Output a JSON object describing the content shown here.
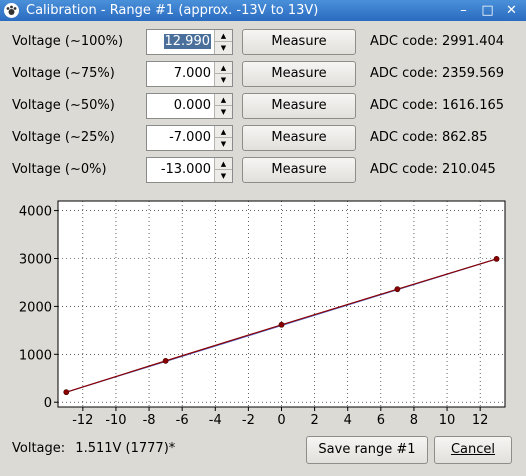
{
  "window": {
    "title": "Calibration - Range #1 (approx. -13V to 13V)",
    "minimize_glyph": "–",
    "maximize_glyph": "□",
    "close_glyph": "✕"
  },
  "rows": [
    {
      "label": "Voltage (~100%)",
      "value": "12.990",
      "button": "Measure",
      "adc": "ADC code: 2991.404",
      "selected": true
    },
    {
      "label": "Voltage (~75%)",
      "value": "7.000",
      "button": "Measure",
      "adc": "ADC code: 2359.569"
    },
    {
      "label": "Voltage (~50%)",
      "value": "0.000",
      "button": "Measure",
      "adc": "ADC code: 1616.165"
    },
    {
      "label": "Voltage (~25%)",
      "value": "-7.000",
      "button": "Measure",
      "adc": "ADC code: 862.85"
    },
    {
      "label": "Voltage (~0%)",
      "value": "-13.000",
      "button": "Measure",
      "adc": "ADC code: 210.045"
    }
  ],
  "chart_data": {
    "type": "line",
    "xlim": [
      -13.5,
      13.5
    ],
    "ylim": [
      -100,
      4200
    ],
    "x_ticks": [
      -12,
      -10,
      -8,
      -6,
      -4,
      -2,
      0,
      2,
      4,
      6,
      8,
      10,
      12
    ],
    "y_ticks": [
      0,
      1000,
      2000,
      3000,
      4000
    ],
    "grid": true,
    "series": [
      {
        "color": "#8b0000",
        "x": [
          -13.0,
          -7.0,
          0.0,
          7.0,
          12.99
        ],
        "y": [
          210.045,
          862.85,
          1616.165,
          2359.569,
          2991.404
        ],
        "markers": true
      }
    ],
    "fit_line_color": "#2040c0"
  },
  "status": {
    "label": "Voltage:",
    "value": "1.511V (1777)*"
  },
  "buttons": {
    "save": "Save range #1",
    "cancel": "Cancel"
  },
  "colors": {
    "titlebar": "#2a6bc0",
    "selection": "#4a6f9b",
    "point": "#8b0000"
  }
}
